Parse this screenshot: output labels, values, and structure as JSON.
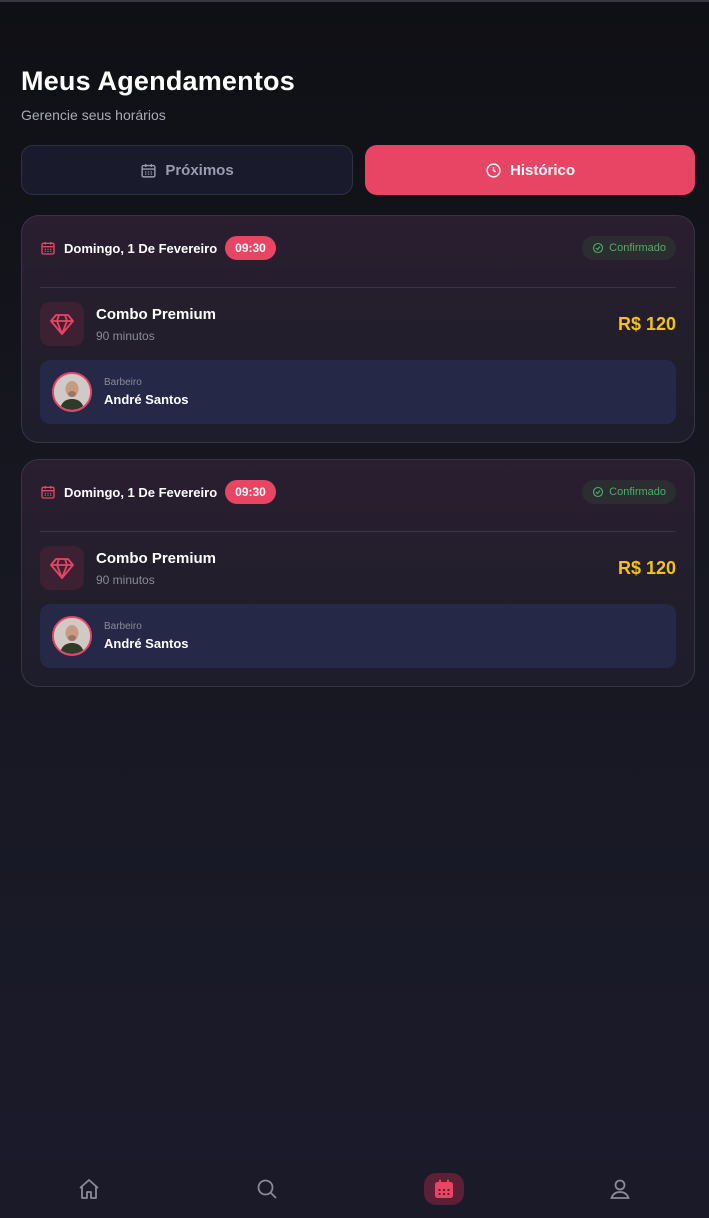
{
  "header": {
    "title": "Meus Agendamentos",
    "subtitle": "Gerencie seus horários"
  },
  "tabs": [
    {
      "label": "Próximos",
      "icon": "calendar-icon",
      "active": false
    },
    {
      "label": "Histórico",
      "icon": "clock-icon",
      "active": true
    }
  ],
  "appointments": [
    {
      "date": "Domingo, 1 De Fevereiro",
      "time": "09:30",
      "status": "Confirmado",
      "service": {
        "name": "Combo Premium",
        "duration": "90 minutos",
        "icon": "diamond-icon"
      },
      "price": "R$ 120",
      "barber": {
        "role": "Barbeiro",
        "name": "André Santos"
      }
    },
    {
      "date": "Domingo, 1 De Fevereiro",
      "time": "09:30",
      "status": "Confirmado",
      "service": {
        "name": "Combo Premium",
        "duration": "90 minutos",
        "icon": "diamond-icon"
      },
      "price": "R$ 120",
      "barber": {
        "role": "Barbeiro",
        "name": "André Santos"
      }
    }
  ],
  "bottom_nav": [
    {
      "icon": "home-icon",
      "active": false
    },
    {
      "icon": "search-icon",
      "active": false
    },
    {
      "icon": "calendar-icon",
      "active": true
    },
    {
      "icon": "user-icon",
      "active": false
    }
  ],
  "colors": {
    "accent": "#e84565",
    "price": "#f4c21a",
    "status": "#4fae63",
    "background": "#1a1a28"
  }
}
